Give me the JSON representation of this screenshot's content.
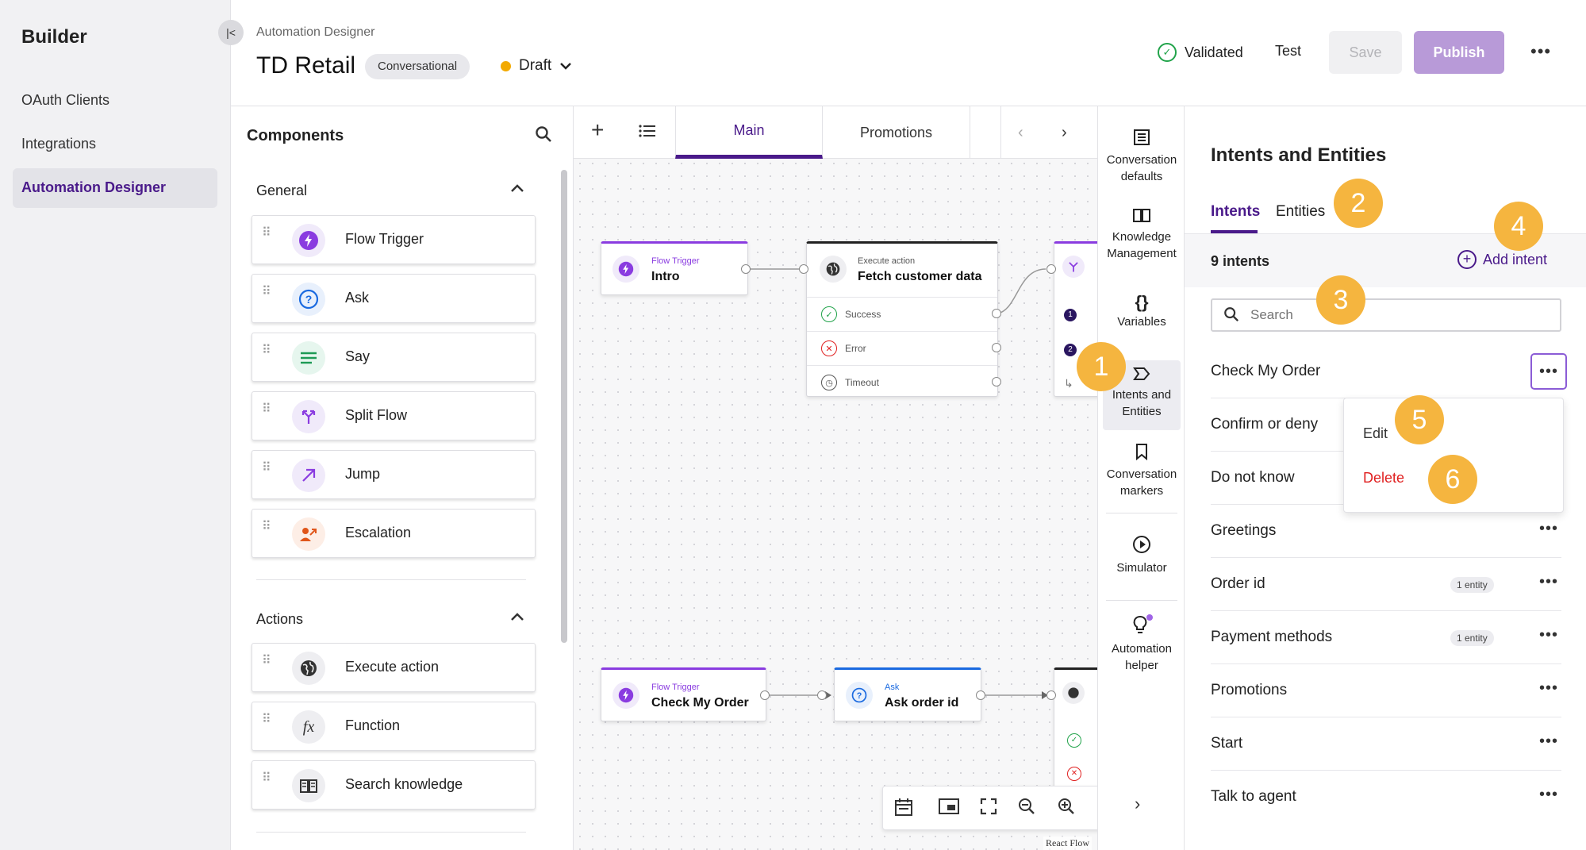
{
  "nav": {
    "brand": "Builder",
    "items": [
      {
        "label": "OAuth Clients"
      },
      {
        "label": "Integrations"
      },
      {
        "label": "Automation Designer"
      }
    ]
  },
  "header": {
    "breadcrumb": "Automation Designer",
    "title": "TD Retail",
    "chip": "Conversational",
    "status": "Draft",
    "validated": "Validated",
    "test": "Test",
    "save": "Save",
    "publish": "Publish",
    "more": "•••"
  },
  "components": {
    "title": "Components",
    "general_label": "General",
    "general": [
      {
        "label": "Flow Trigger",
        "icon": "lightning-icon"
      },
      {
        "label": "Ask",
        "icon": "question-icon"
      },
      {
        "label": "Say",
        "icon": "lines-icon"
      },
      {
        "label": "Split Flow",
        "icon": "split-icon"
      },
      {
        "label": "Jump",
        "icon": "arrow-up-right-icon"
      },
      {
        "label": "Escalation",
        "icon": "escalation-icon"
      }
    ],
    "actions_label": "Actions",
    "actions": [
      {
        "label": "Execute action",
        "icon": "globe-icon"
      },
      {
        "label": "Function",
        "icon": "function-icon"
      },
      {
        "label": "Search knowledge",
        "icon": "book-icon"
      }
    ]
  },
  "canvas": {
    "tabs": [
      "Main",
      "Promotions"
    ],
    "nodes": {
      "intro_kind": "Flow Trigger",
      "intro_name": "Intro",
      "fetch_kind": "Execute action",
      "fetch_name": "Fetch customer data",
      "out_success": "Success",
      "out_error": "Error",
      "out_timeout": "Timeout",
      "cmo_kind": "Flow Trigger",
      "cmo_name": "Check My Order",
      "ask_kind": "Ask",
      "ask_name": "Ask order id"
    },
    "react_flow": "React Flow"
  },
  "rail": {
    "items": [
      {
        "label": "Conversation defaults"
      },
      {
        "label": "Knowledge Management"
      },
      {
        "label": "Variables"
      },
      {
        "label": "Intents and Entities"
      },
      {
        "label": "Conversation markers"
      },
      {
        "label": "Simulator"
      },
      {
        "label": "Automation helper"
      }
    ]
  },
  "panel": {
    "title": "Intents and Entities",
    "tab_intents": "Intents",
    "tab_entities": "Entities",
    "count": "9 intents",
    "add_intent": "Add intent",
    "search_placeholder": "Search",
    "intents": [
      {
        "name": "Check My Order",
        "badge": ""
      },
      {
        "name": "Confirm or deny",
        "badge": ""
      },
      {
        "name": "Do not know",
        "badge": ""
      },
      {
        "name": "Greetings",
        "badge": ""
      },
      {
        "name": "Order id",
        "badge": "1 entity"
      },
      {
        "name": "Payment methods",
        "badge": "1 entity"
      },
      {
        "name": "Promotions",
        "badge": ""
      },
      {
        "name": "Start",
        "badge": ""
      },
      {
        "name": "Talk to agent",
        "badge": ""
      }
    ],
    "menu": {
      "edit": "Edit",
      "delete": "Delete"
    }
  },
  "callouts": [
    "1",
    "2",
    "3",
    "4",
    "5",
    "6"
  ],
  "colors": {
    "accent": "#4a1a8a",
    "publish": "#b89ad8",
    "callout": "#f5b53f",
    "delete": "#e02020",
    "draft_dot": "#f2a900"
  }
}
